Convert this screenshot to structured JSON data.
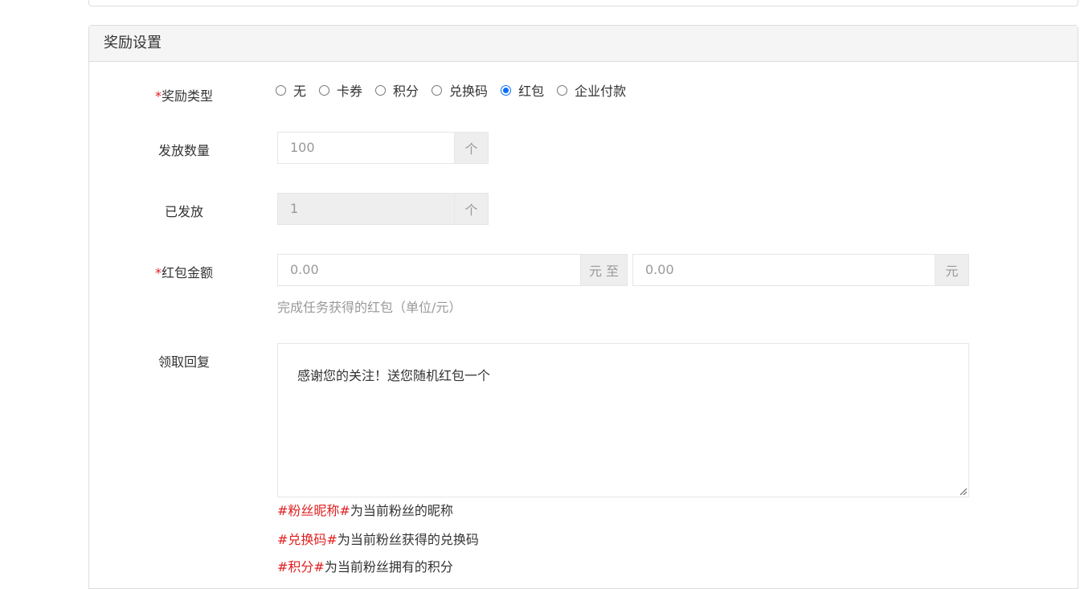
{
  "panel": {
    "title": "奖励设置"
  },
  "reward_type": {
    "required_mark": "*",
    "label": "奖励类型",
    "options": [
      {
        "label": "无",
        "checked": false
      },
      {
        "label": "卡券",
        "checked": false
      },
      {
        "label": "积分",
        "checked": false
      },
      {
        "label": "兑换码",
        "checked": false
      },
      {
        "label": "红包",
        "checked": true
      },
      {
        "label": "企业付款",
        "checked": false
      }
    ]
  },
  "issue_count": {
    "label": "发放数量",
    "value": "100",
    "unit": "个"
  },
  "issued": {
    "label": "已发放",
    "value": "1",
    "unit": "个"
  },
  "red_packet_amount": {
    "required_mark": "*",
    "label": "红包金额",
    "min_value": "0.00",
    "min_unit": "元 至",
    "max_value": "0.00",
    "max_unit": "元",
    "help": "完成任务获得的红包（单位/元）"
  },
  "reply": {
    "label": "领取回复",
    "text": "感谢您的关注！送您随机红包一个"
  },
  "tips": [
    {
      "tag": "#粉丝昵称#",
      "desc": "为当前粉丝的昵称"
    },
    {
      "tag": "#兑换码#",
      "desc": "为当前粉丝获得的兑换码"
    },
    {
      "tag": "#积分#",
      "desc": "为当前粉丝拥有的积分"
    }
  ]
}
